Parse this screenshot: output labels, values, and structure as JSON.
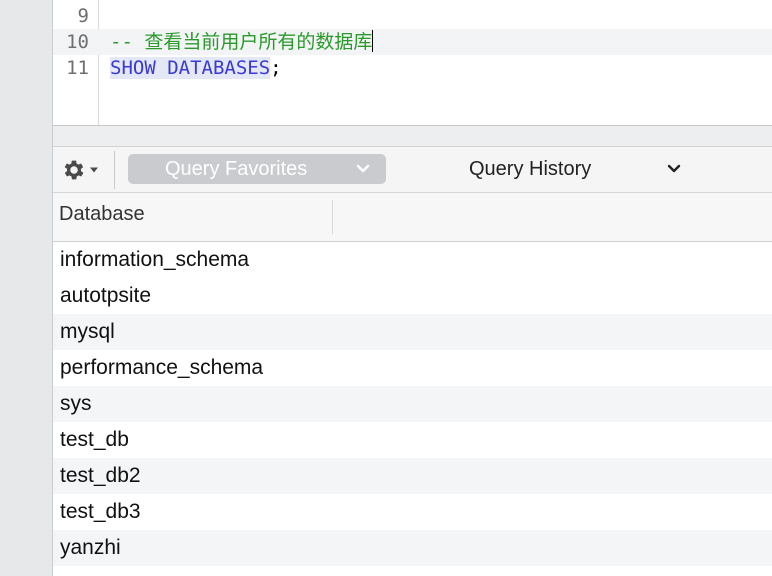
{
  "editor": {
    "lines": [
      {
        "num": "9",
        "text": ""
      },
      {
        "num": "10",
        "comment": "-- 查看当前用户所有的数据库"
      },
      {
        "num": "11",
        "keyword": "SHOW DATABASES",
        "punct": ";"
      }
    ]
  },
  "toolbar": {
    "gear_icon": "gear-icon",
    "favorites_label": "Query Favorites",
    "history_label": "Query History"
  },
  "results": {
    "columns": [
      "Database"
    ],
    "rows": [
      "information_schema",
      "autotpsite",
      "mysql",
      "performance_schema",
      "sys",
      "test_db",
      "test_db2",
      "test_db3",
      "yanzhi"
    ]
  }
}
